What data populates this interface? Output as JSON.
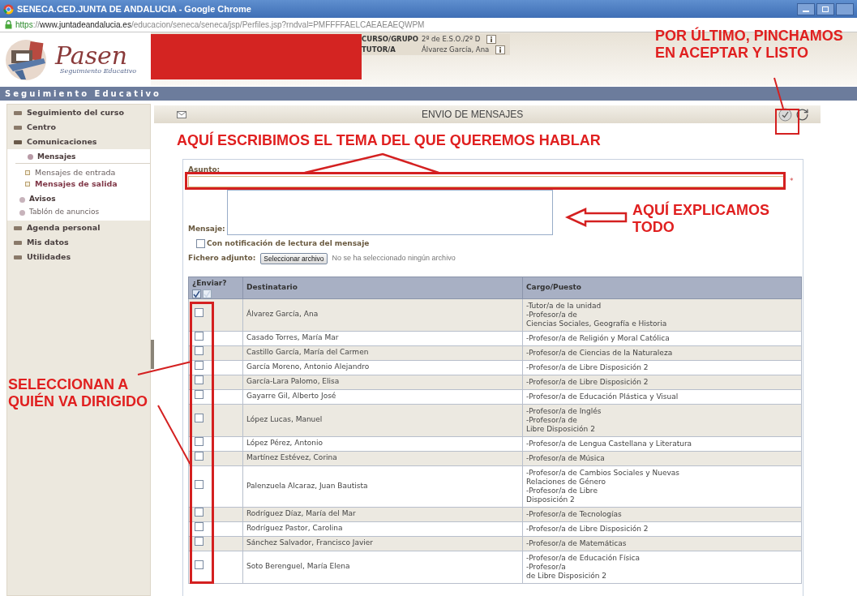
{
  "browser": {
    "title": "SENECA.CED.JUNTA DE ANDALUCIA - Google Chrome",
    "url": {
      "scheme": "https",
      "separator": "://",
      "host": "www.juntadeandalucia.es",
      "path": "/educacion/seneca/seneca/jsp/Perfiles.jsp?rndval=PMFFFFAELCAEAEAEQWPM"
    }
  },
  "header": {
    "logo_text": "Pasen",
    "logo_subtitle": "Seguimiento Educativo",
    "info": [
      {
        "label": "CURSO/GRUPO",
        "value": "2º de E.S.O./2º D"
      },
      {
        "label": "TUTOR/A",
        "value": "Álvarez García, Ana"
      }
    ]
  },
  "banner": "Seguimiento Educativo",
  "sidebar": {
    "items": [
      {
        "label": "Seguimiento del curso",
        "expanded": false,
        "selected": false
      },
      {
        "label": "Centro",
        "expanded": false,
        "selected": false
      },
      {
        "label": "Comunicaciones",
        "expanded": true,
        "selected": false,
        "children": [
          {
            "label": "Mensajes",
            "kind": "group",
            "expanded": true,
            "selected": false,
            "children": [
              {
                "label": "Mensajes de entrada",
                "selected": false
              },
              {
                "label": "Mensajes de salida",
                "selected": true
              }
            ]
          },
          {
            "label": "Avisos",
            "kind": "group",
            "expanded": false,
            "selected": false
          },
          {
            "label": "Tablón de anuncios",
            "kind": "link",
            "expanded": false,
            "selected": false
          }
        ]
      },
      {
        "label": "Agenda personal",
        "expanded": false,
        "selected": false
      },
      {
        "label": "Mis datos",
        "expanded": false,
        "selected": false
      },
      {
        "label": "Utilidades",
        "expanded": false,
        "selected": false
      }
    ]
  },
  "panel": {
    "title": "ENVIO DE MENSAJES"
  },
  "form": {
    "subject_label": "Asunto:",
    "required_mark": "*",
    "message_label": "Mensaje:",
    "read_receipt": {
      "label": "Con notificación de lectura del mensaje",
      "checked": false
    },
    "attachment": {
      "label": "Fichero adjunto:",
      "button": "Seleccionar archivo",
      "status": "No se ha seleccionado ningún archivo"
    }
  },
  "table": {
    "columns": [
      "¿Enviar?",
      "Destinatario",
      "Cargo/Puesto"
    ],
    "rows": [
      {
        "name": "Álvarez García, Ana",
        "checked": false,
        "cargo": [
          "-Tutor/a de la unidad",
          "-Profesor/a de",
          "Ciencias Sociales, Geografía e Historia"
        ]
      },
      {
        "name": "Casado Torres, María Mar",
        "checked": false,
        "cargo": [
          "-Profesor/a de Religión y Moral Católica"
        ]
      },
      {
        "name": "Castillo García, María del Carmen",
        "checked": false,
        "cargo": [
          "-Profesor/a de Ciencias de la Naturaleza"
        ]
      },
      {
        "name": "García Moreno, Antonio Alejandro",
        "checked": false,
        "cargo": [
          "-Profesor/a de Libre Disposición 2"
        ]
      },
      {
        "name": "García-Lara Palomo, Elisa",
        "checked": false,
        "cargo": [
          "-Profesor/a de Libre Disposición 2"
        ]
      },
      {
        "name": "Gayarre Gil, Alberto José",
        "checked": false,
        "cargo": [
          "-Profesor/a de Educación Plástica y Visual"
        ]
      },
      {
        "name": "López Lucas, Manuel",
        "checked": false,
        "cargo": [
          "-Profesor/a de Inglés",
          "-Profesor/a de",
          "Libre Disposición 2"
        ]
      },
      {
        "name": "López Pérez, Antonio",
        "checked": false,
        "cargo": [
          "-Profesor/a de Lengua Castellana y Literatura"
        ]
      },
      {
        "name": "Martínez Estévez, Corina",
        "checked": false,
        "cargo": [
          "-Profesor/a de Música"
        ]
      },
      {
        "name": "Palenzuela Alcaraz, Juan Bautista",
        "checked": false,
        "cargo": [
          "-Profesor/a de Cambios Sociales y Nuevas",
          "Relaciones de Género",
          "-Profesor/a de Libre",
          "Disposición 2"
        ]
      },
      {
        "name": "Rodríguez Díaz, María del Mar",
        "checked": false,
        "cargo": [
          "-Profesor/a de Tecnologías"
        ]
      },
      {
        "name": "Rodríguez Pastor, Carolina",
        "checked": false,
        "cargo": [
          "-Profesor/a de Libre Disposición 2"
        ]
      },
      {
        "name": "Sánchez Salvador, Francisco Javier",
        "checked": false,
        "cargo": [
          "-Profesor/a de Matemáticas"
        ]
      },
      {
        "name": "Soto Berenguel, María Elena",
        "checked": false,
        "cargo": [
          "-Profesor/a de Educación Física",
          "-Profesor/a",
          "de Libre Disposición 2"
        ]
      }
    ]
  },
  "annotations": [
    {
      "kind": "accept",
      "lines": [
        "POR ÚLTIMO, PINCHAMOS",
        "EN ACEPTAR Y LISTO"
      ]
    },
    {
      "kind": "subject",
      "lines": [
        "AQUÍ ESCRIBIMOS EL TEMA DEL QUE QUEREMOS HABLAR"
      ]
    },
    {
      "kind": "message",
      "lines": [
        "AQUÍ EXPLICAMOS",
        "TODO"
      ]
    },
    {
      "kind": "recipients",
      "lines": [
        "SELECCIONAN A",
        "QUIÉN VA DIRIGIDO"
      ]
    }
  ]
}
